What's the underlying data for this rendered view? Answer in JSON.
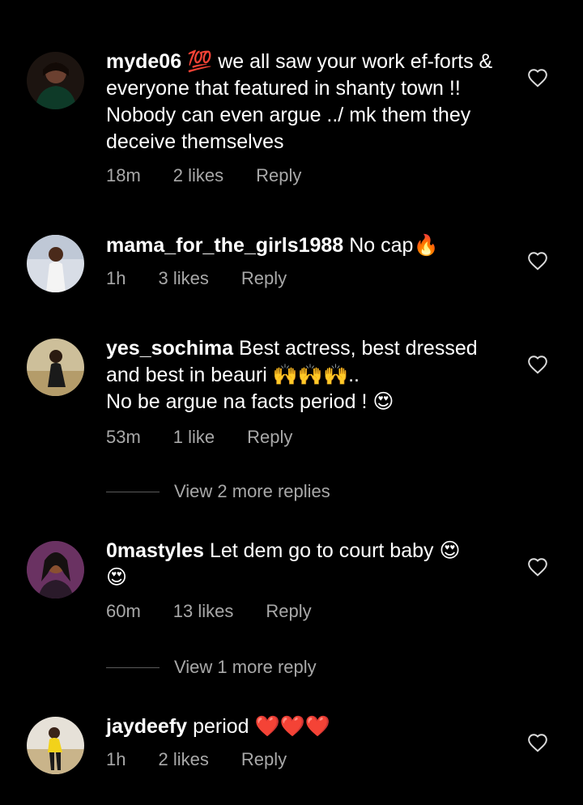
{
  "comments": [
    {
      "username": "myde06",
      "badge_emoji": "💯",
      "text": "we all saw your work ef-forts & everyone that featured in shanty town !! Nobody can even argue ../ mk them they deceive themselves",
      "time": "18m",
      "likes": "2 likes",
      "reply": "Reply",
      "avatar_icon": "user-avatar-photo"
    },
    {
      "username": "mama_for_the_girls1988",
      "text": "No cap",
      "trailing_emoji": "🔥",
      "time": "1h",
      "likes": "3 likes",
      "reply": "Reply",
      "avatar_icon": "user-avatar-photo"
    },
    {
      "username": "yes_sochima",
      "text_part1": "Best actress, best dressed and best in beauri",
      "text_part2": "..",
      "text_part3": "No be argue na facts period !",
      "inline_emojis": "🙌🙌🙌",
      "trailing_emoji": "😍",
      "time": "53m",
      "likes": "1 like",
      "reply": "Reply",
      "avatar_icon": "user-avatar-photo"
    },
    {
      "username": "0mastyles",
      "text": "Let dem go to court baby",
      "trailing_emoji": "😍",
      "second_line_emoji": "😍",
      "time": "60m",
      "likes": "13 likes",
      "reply": "Reply",
      "avatar_icon": "user-avatar-photo"
    },
    {
      "username": "jaydeefy",
      "text": "period",
      "trailing_emoji": "❤️❤️❤️",
      "time": "1h",
      "likes": "2 likes",
      "reply": "Reply",
      "avatar_icon": "user-avatar-photo"
    }
  ],
  "view_more": [
    {
      "label": "View 2 more replies"
    },
    {
      "label": "View 1 more reply"
    }
  ],
  "colors": {
    "background": "#000000",
    "text_primary": "#ffffff",
    "text_secondary": "#a8a8a8",
    "heart_outline": "#dbdbdb"
  }
}
